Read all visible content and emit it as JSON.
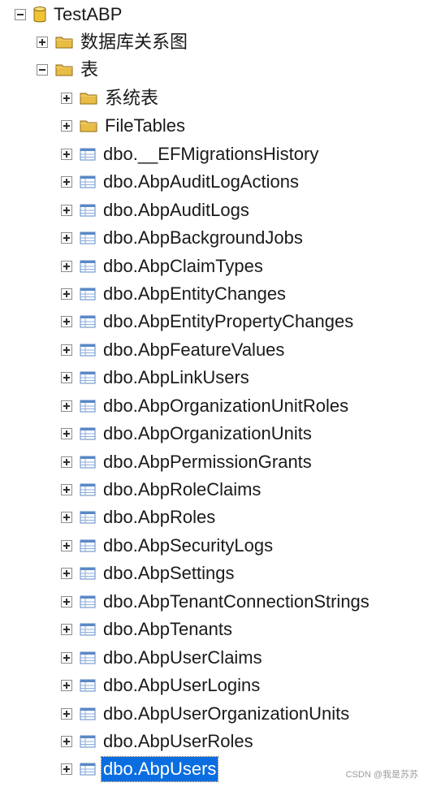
{
  "tree": {
    "root": {
      "label": "TestABP",
      "icon": "database-icon",
      "expanded": true
    },
    "database_children": [
      {
        "label": "数据库关系图",
        "icon": "folder-icon",
        "expanded": false
      },
      {
        "label": "表",
        "icon": "folder-icon",
        "expanded": true
      }
    ],
    "table_children": [
      {
        "label": "系统表",
        "icon": "folder-icon"
      },
      {
        "label": "FileTables",
        "icon": "folder-icon"
      },
      {
        "label": "dbo.__EFMigrationsHistory",
        "icon": "table-icon"
      },
      {
        "label": "dbo.AbpAuditLogActions",
        "icon": "table-icon"
      },
      {
        "label": "dbo.AbpAuditLogs",
        "icon": "table-icon"
      },
      {
        "label": "dbo.AbpBackgroundJobs",
        "icon": "table-icon"
      },
      {
        "label": "dbo.AbpClaimTypes",
        "icon": "table-icon"
      },
      {
        "label": "dbo.AbpEntityChanges",
        "icon": "table-icon"
      },
      {
        "label": "dbo.AbpEntityPropertyChanges",
        "icon": "table-icon"
      },
      {
        "label": "dbo.AbpFeatureValues",
        "icon": "table-icon"
      },
      {
        "label": "dbo.AbpLinkUsers",
        "icon": "table-icon"
      },
      {
        "label": "dbo.AbpOrganizationUnitRoles",
        "icon": "table-icon"
      },
      {
        "label": "dbo.AbpOrganizationUnits",
        "icon": "table-icon"
      },
      {
        "label": "dbo.AbpPermissionGrants",
        "icon": "table-icon"
      },
      {
        "label": "dbo.AbpRoleClaims",
        "icon": "table-icon"
      },
      {
        "label": "dbo.AbpRoles",
        "icon": "table-icon"
      },
      {
        "label": "dbo.AbpSecurityLogs",
        "icon": "table-icon"
      },
      {
        "label": "dbo.AbpSettings",
        "icon": "table-icon"
      },
      {
        "label": "dbo.AbpTenantConnectionStrings",
        "icon": "table-icon"
      },
      {
        "label": "dbo.AbpTenants",
        "icon": "table-icon"
      },
      {
        "label": "dbo.AbpUserClaims",
        "icon": "table-icon"
      },
      {
        "label": "dbo.AbpUserLogins",
        "icon": "table-icon"
      },
      {
        "label": "dbo.AbpUserOrganizationUnits",
        "icon": "table-icon"
      },
      {
        "label": "dbo.AbpUserRoles",
        "icon": "table-icon"
      },
      {
        "label": "dbo.AbpUsers",
        "icon": "table-icon",
        "selected": true
      }
    ],
    "selected_item": "dbo.AbpUsers"
  },
  "colors": {
    "selection_background": "#0a6ee1",
    "selection_text": "#ffffff",
    "folder": "#e8bc45",
    "database": "#f1c232",
    "table_icon": "#5b88c6"
  },
  "watermark": "CSDN @我是苏苏"
}
